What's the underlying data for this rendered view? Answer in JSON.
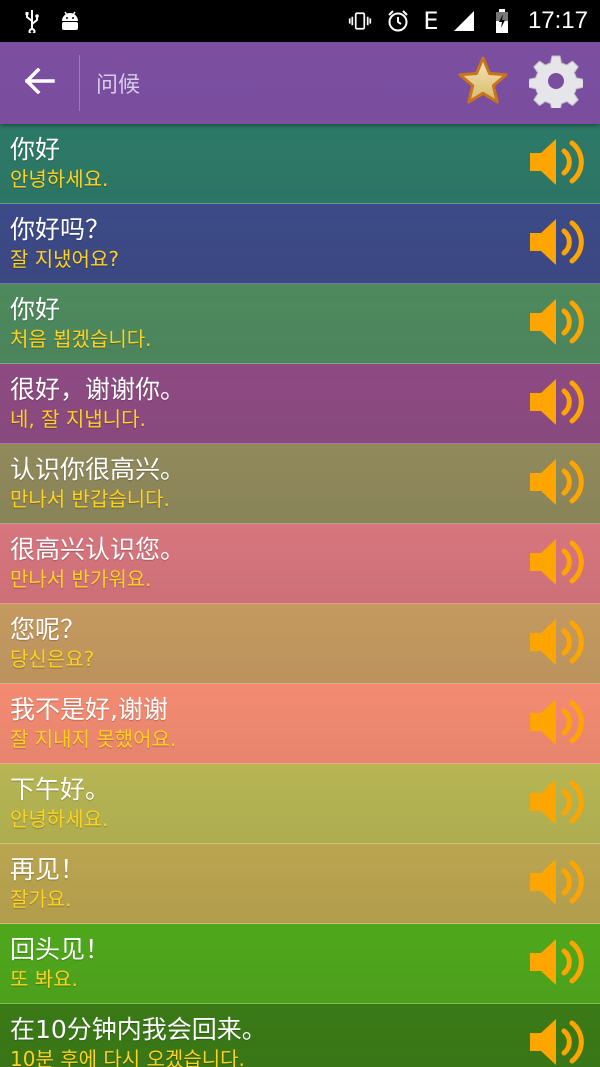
{
  "status_bar": {
    "time": "17:17",
    "network_label": "E",
    "left_icons": [
      "usb-icon",
      "android-icon"
    ],
    "right_icons": [
      "vibrate-icon",
      "alarm-icon",
      "signal-icon",
      "battery-icon"
    ]
  },
  "app_bar": {
    "title": "问候",
    "back_icon": "arrow-left-icon",
    "star_icon": "star-icon",
    "settings_icon": "gear-icon"
  },
  "colors": {
    "app_bar": "#7a4d9f",
    "chinese_text": "#ffffff",
    "korean_text": "#ffd21e",
    "speaker": "#ffa500"
  },
  "phrases": [
    {
      "cn": "你好",
      "kr": "안녕하세요.",
      "bg": "#2d7a68"
    },
    {
      "cn": "你好吗？",
      "kr": "잘 지냈어요?",
      "bg": "#3c4a88"
    },
    {
      "cn": "你好",
      "kr": "처음 뵙겠습니다.",
      "bg": "#4e8a5e"
    },
    {
      "cn": "很好，谢谢你。",
      "kr": "네, 잘 지냅니다.",
      "bg": "#8e4b83"
    },
    {
      "cn": "认识你很高兴。",
      "kr": "만나서 반갑습니다.",
      "bg": "#908a5c"
    },
    {
      "cn": "很高兴认识您。",
      "kr": "만나서 반가워요.",
      "bg": "#d8757d"
    },
    {
      "cn": "您呢？",
      "kr": "당신은요?",
      "bg": "#c59a60"
    },
    {
      "cn": "我不是好,谢谢",
      "kr": "잘 지내지 못했어요.",
      "bg": "#f48b72"
    },
    {
      "cn": "下午好。",
      "kr": "안녕하세요.",
      "bg": "#b7b653"
    },
    {
      "cn": "再见！",
      "kr": "잘가요.",
      "bg": "#bba550"
    },
    {
      "cn": "回头见！",
      "kr": "또 봐요.",
      "bg": "#4fa81b"
    },
    {
      "cn": "在10分钟内我会回来。",
      "kr": "10분 후에 다시 오겠습니다.",
      "bg": "#3a7a16"
    }
  ]
}
